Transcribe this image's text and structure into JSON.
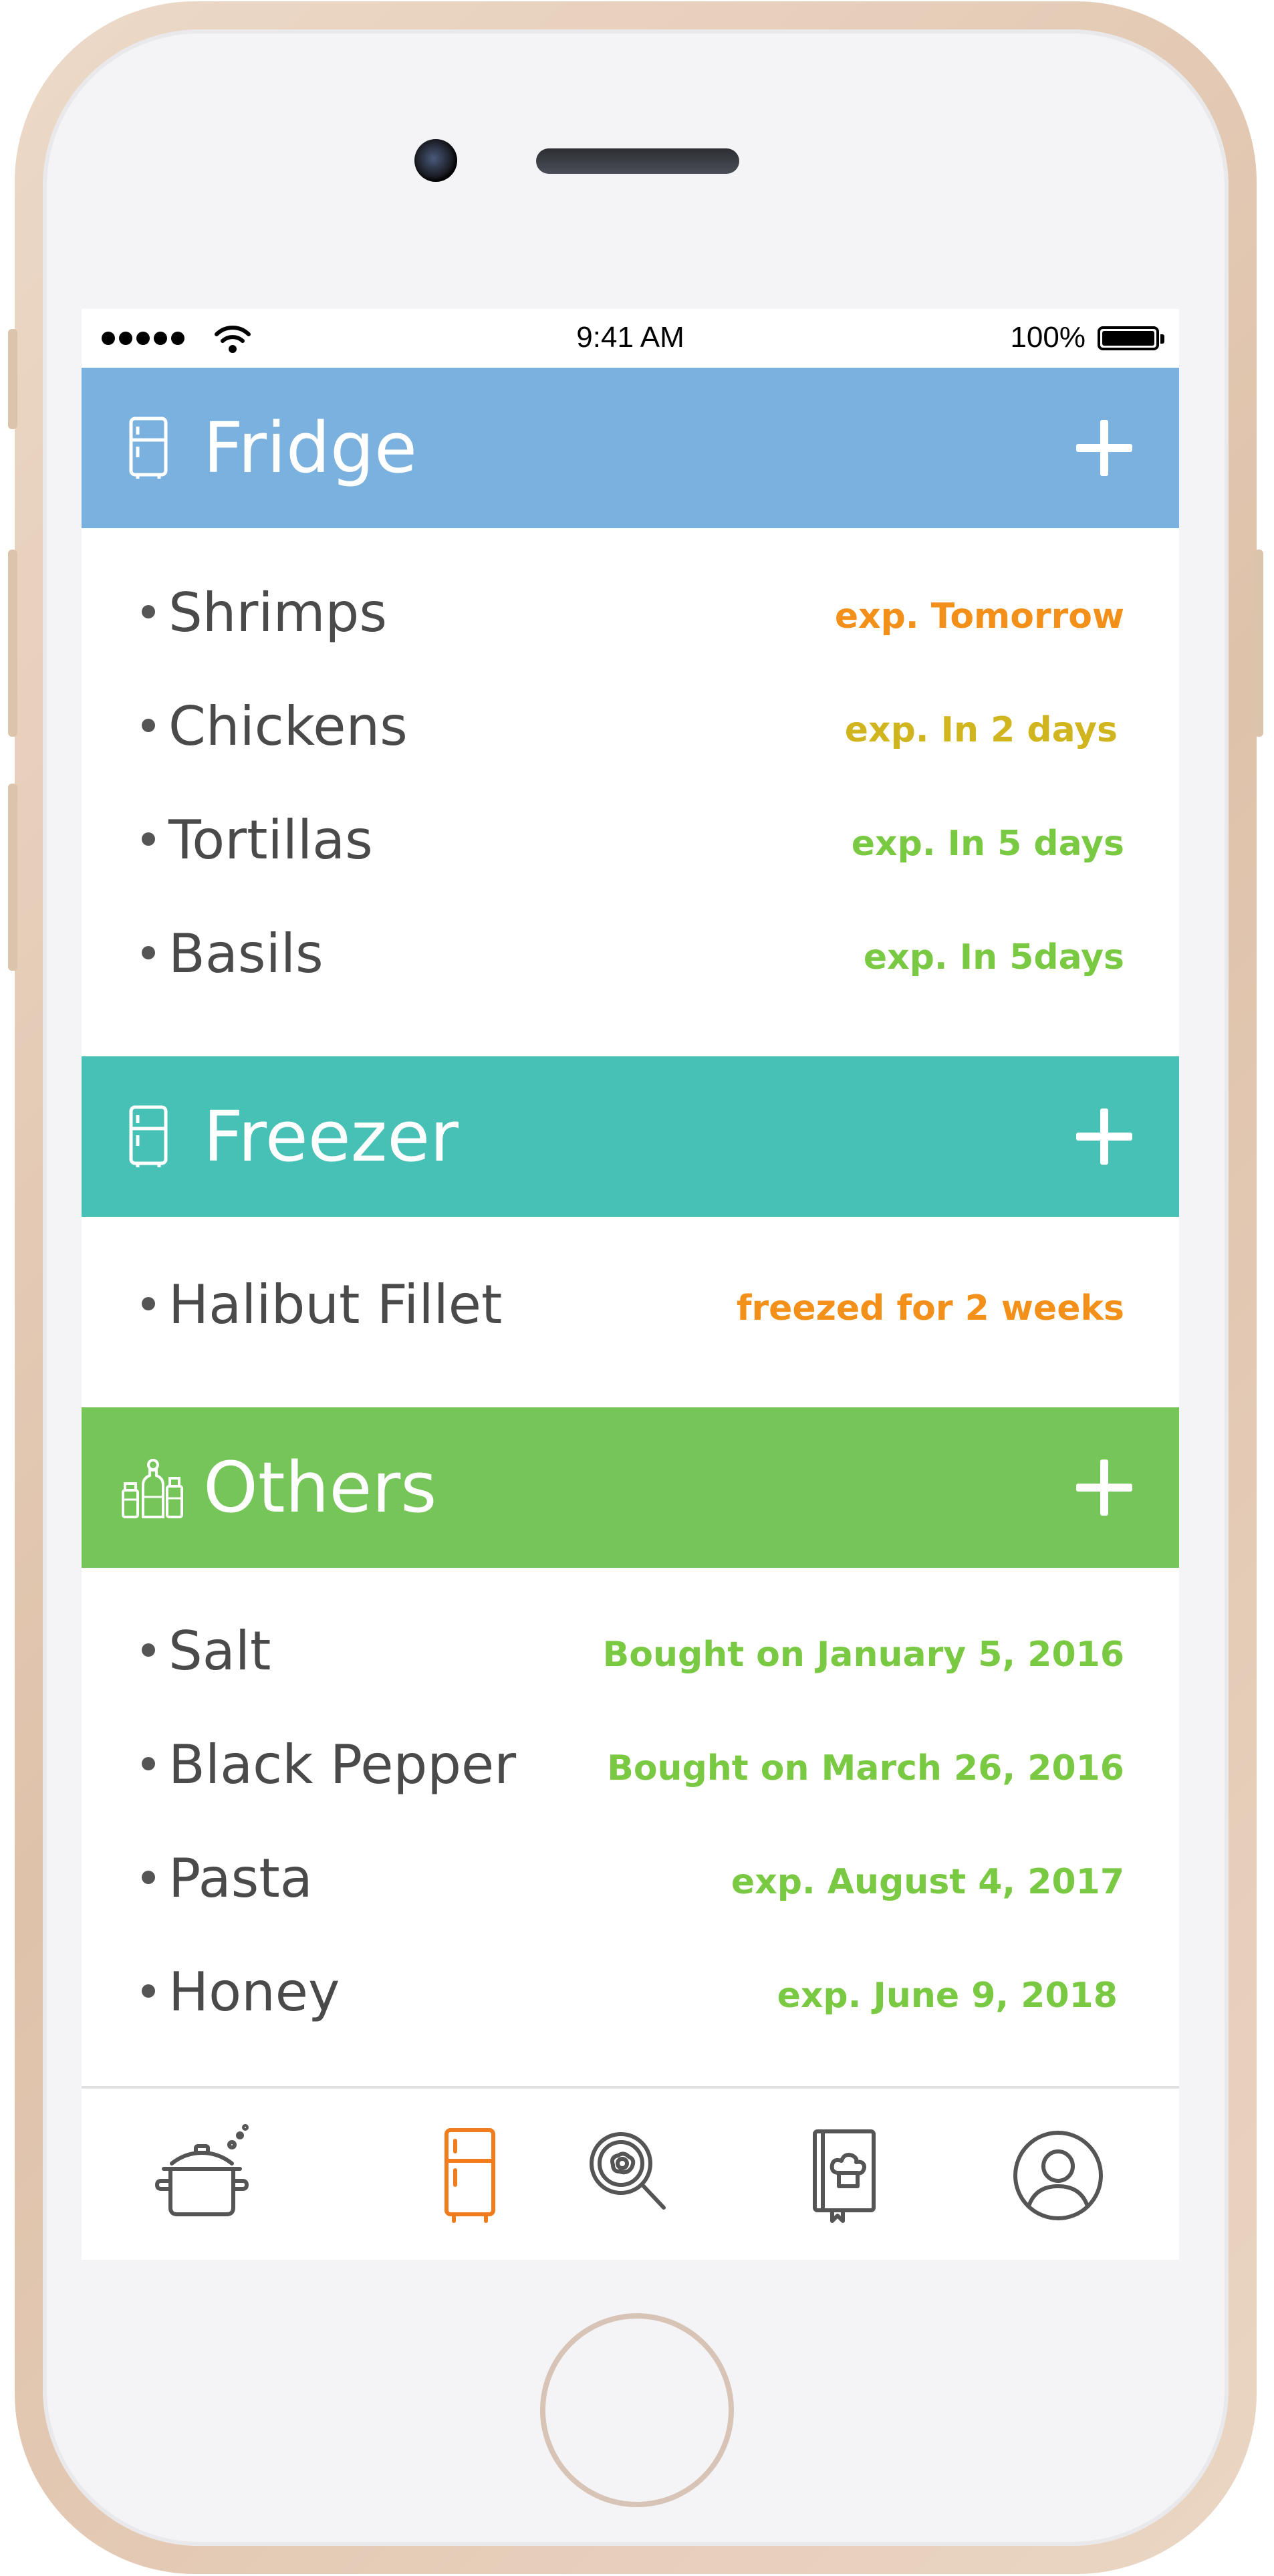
{
  "status_bar": {
    "time": "9:41 AM",
    "battery": "100%"
  },
  "sections": [
    {
      "title": "Fridge",
      "color": "#7ab1de",
      "icon": "fridge-icon",
      "items": [
        {
          "name": "Shrimps",
          "status": "exp. Tomorrow",
          "status_color": "#f39019"
        },
        {
          "name": "Chickens",
          "status": "exp. In 2 days",
          "status_color": "#d0b51e"
        },
        {
          "name": "Tortillas",
          "status": "exp. In 5 days",
          "status_color": "#7ac943"
        },
        {
          "name": "Basils",
          "status": "exp. In 5days",
          "status_color": "#7ac943"
        }
      ]
    },
    {
      "title": "Freezer",
      "color": "#47c1b6",
      "icon": "fridge-icon",
      "items": [
        {
          "name": "Halibut Fillet",
          "status": "freezed for 2 weeks",
          "status_color": "#f39019"
        }
      ]
    },
    {
      "title": "Others",
      "color": "#76c559",
      "icon": "spice-jars-icon",
      "items": [
        {
          "name": "Salt",
          "status": "Bought on January 5, 2016",
          "status_color": "#7ac943"
        },
        {
          "name": "Black Pepper",
          "status": "Bought on March 26, 2016",
          "status_color": "#7ac943"
        },
        {
          "name": "Pasta",
          "status": "exp. August 4, 2017",
          "status_color": "#7ac943"
        },
        {
          "name": "Honey",
          "status": "exp. June 9, 2018",
          "status_color": "#7ac943"
        }
      ]
    }
  ],
  "tabbar": {
    "tabs": [
      {
        "icon": "cooking-pot-icon",
        "active": false
      },
      {
        "icon": "fridge-icon",
        "active": true
      },
      {
        "icon": "search-pan-icon",
        "active": false
      },
      {
        "icon": "recipe-book-icon",
        "active": false
      },
      {
        "icon": "profile-icon",
        "active": false
      }
    ],
    "active_color": "#f07c1e",
    "inactive_color": "#555555"
  }
}
